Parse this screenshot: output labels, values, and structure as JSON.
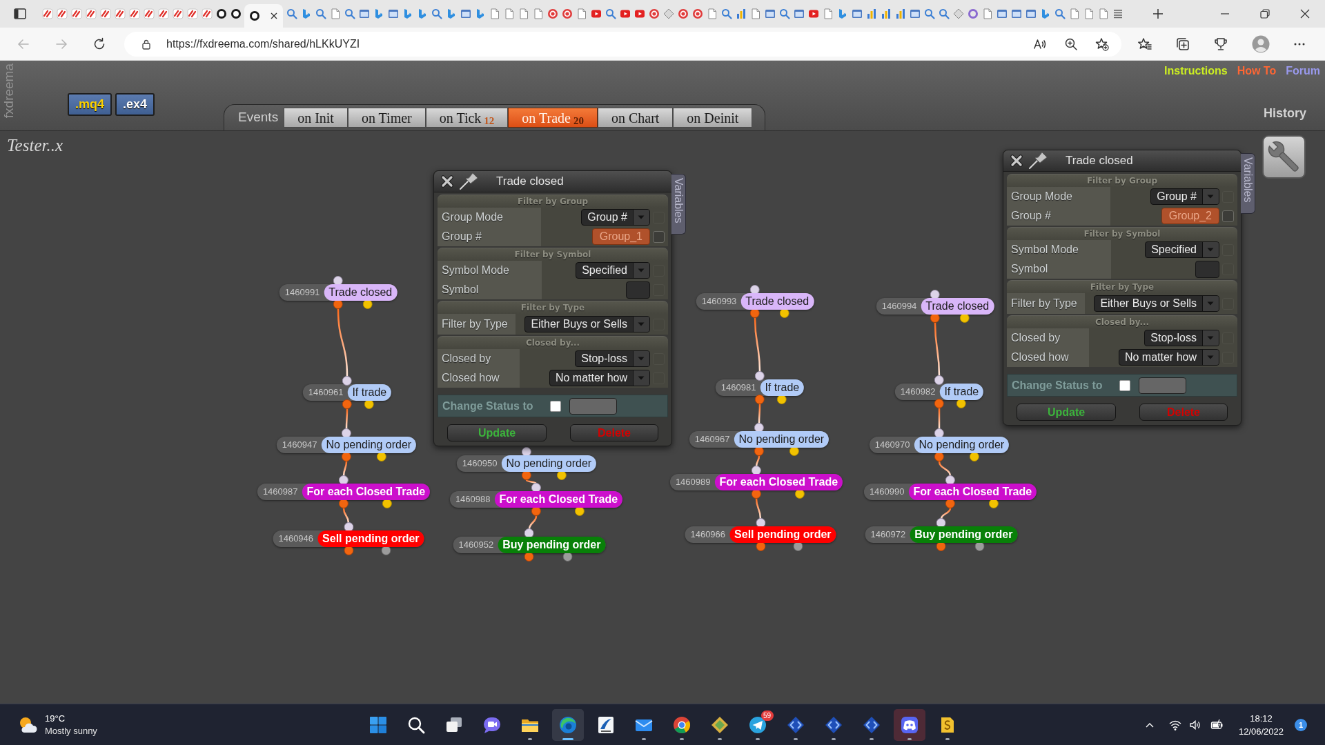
{
  "browser": {
    "tabs": [
      {
        "selected": false
      },
      {
        "selected": false
      },
      {
        "selected": false
      },
      {
        "selected": false
      },
      {
        "selected": false
      },
      {
        "selected": false
      },
      {
        "selected": false
      },
      {
        "selected": false
      },
      {
        "selected": false
      },
      {
        "selected": false
      },
      {
        "selected": false
      },
      {
        "selected": false
      },
      {
        "selected": false
      },
      {
        "selected": false
      },
      {
        "selected": true
      },
      {
        "selected": false
      },
      {
        "selected": false
      },
      {
        "selected": false
      },
      {
        "selected": false
      },
      {
        "selected": false
      },
      {
        "selected": false
      },
      {
        "selected": false
      },
      {
        "selected": false
      },
      {
        "selected": false
      },
      {
        "selected": false
      },
      {
        "selected": false
      },
      {
        "selected": false
      },
      {
        "selected": false
      },
      {
        "selected": false
      },
      {
        "selected": false
      },
      {
        "selected": false
      },
      {
        "selected": false
      },
      {
        "selected": false
      },
      {
        "selected": false
      },
      {
        "selected": false
      },
      {
        "selected": false
      },
      {
        "selected": false
      },
      {
        "selected": false
      },
      {
        "selected": false
      },
      {
        "selected": false
      },
      {
        "selected": false
      },
      {
        "selected": false
      },
      {
        "selected": false
      },
      {
        "selected": false
      },
      {
        "selected": false
      },
      {
        "selected": false
      },
      {
        "selected": false
      },
      {
        "selected": false
      },
      {
        "selected": false
      },
      {
        "selected": false
      },
      {
        "selected": false
      },
      {
        "selected": false
      },
      {
        "selected": false
      },
      {
        "selected": false
      },
      {
        "selected": false
      },
      {
        "selected": false
      },
      {
        "selected": false
      },
      {
        "selected": false
      },
      {
        "selected": false
      },
      {
        "selected": false
      },
      {
        "selected": false
      },
      {
        "selected": false
      },
      {
        "selected": false
      },
      {
        "selected": false
      },
      {
        "selected": false
      },
      {
        "selected": false
      },
      {
        "selected": false
      },
      {
        "selected": false
      },
      {
        "selected": false
      },
      {
        "selected": false
      },
      {
        "selected": false
      },
      {
        "selected": false
      },
      {
        "selected": false
      }
    ],
    "address": "https://fxdreema.com/shared/hLKkUYZI"
  },
  "header": {
    "brand": "fxdreema",
    "exports": [
      ".mq4",
      ".ex4"
    ],
    "events_label": "Events",
    "tabs": [
      {
        "label": "on Init",
        "selected": false
      },
      {
        "label": "on Timer",
        "selected": false
      },
      {
        "label": "on Tick",
        "count": "12",
        "selected": false
      },
      {
        "label": "on Trade",
        "count": "20",
        "selected": true
      },
      {
        "label": "on Chart",
        "selected": false
      },
      {
        "label": "on Deinit",
        "selected": false
      }
    ],
    "links": [
      {
        "label": "Instructions",
        "color": "#ccee22"
      },
      {
        "label": "How To",
        "color": "#ff6633"
      },
      {
        "label": "Forum",
        "color": "#9999ee"
      }
    ],
    "history": "History"
  },
  "project": "Tester..x",
  "panels": [
    {
      "title": "Trade closed",
      "side_tab": "Variables",
      "sections": [
        {
          "heading": "Filter by Group",
          "rows": [
            {
              "label": "Group Mode",
              "kind": "select",
              "value": "Group #",
              "checked": false
            },
            {
              "label": "Group #",
              "kind": "tag",
              "value": "Group_1",
              "checked": false
            }
          ]
        },
        {
          "heading": "Filter by Symbol",
          "rows": [
            {
              "label": "Symbol Mode",
              "kind": "select",
              "value": "Specified",
              "checked": false
            },
            {
              "label": "Symbol",
              "kind": "input",
              "checked": false
            }
          ]
        },
        {
          "heading": "Filter by Type",
          "rows": [
            {
              "label": "Filter by Type",
              "kind": "select",
              "value": "Either Buys or Sells",
              "checked": false
            }
          ]
        },
        {
          "heading": "Closed by...",
          "rows": [
            {
              "label": "Closed by",
              "kind": "select",
              "value": "Stop-loss",
              "checked": false
            },
            {
              "label": "Closed how",
              "kind": "select",
              "value": "No matter how",
              "checked": false
            }
          ]
        }
      ],
      "status": {
        "label": "Change Status to",
        "checked": false
      },
      "buttons": [
        {
          "label": "Update",
          "kind": "update"
        },
        {
          "label": "Delete",
          "kind": "delete"
        }
      ]
    },
    {
      "title": "Trade closed",
      "side_tab": "Variables",
      "sections": [
        {
          "heading": "Filter by Group",
          "rows": [
            {
              "label": "Group Mode",
              "kind": "select",
              "value": "Group #",
              "checked": false
            },
            {
              "label": "Group #",
              "kind": "tag",
              "value": "Group_2",
              "checked": false
            }
          ]
        },
        {
          "heading": "Filter by Symbol",
          "rows": [
            {
              "label": "Symbol Mode",
              "kind": "select",
              "value": "Specified",
              "checked": false
            },
            {
              "label": "Symbol",
              "kind": "input",
              "checked": false
            }
          ]
        },
        {
          "heading": "Filter by Type",
          "rows": [
            {
              "label": "Filter by Type",
              "kind": "select",
              "value": "Either Buys or Sells",
              "checked": false
            }
          ]
        },
        {
          "heading": "Closed by...",
          "rows": [
            {
              "label": "Closed by",
              "kind": "select",
              "value": "Stop-loss",
              "checked": false
            },
            {
              "label": "Closed how",
              "kind": "select",
              "value": "No matter how",
              "checked": false
            }
          ]
        }
      ],
      "status": {
        "label": "Change Status to",
        "checked": false
      },
      "buttons": [
        {
          "label": "Update",
          "kind": "update"
        },
        {
          "label": "Delete",
          "kind": "delete"
        }
      ]
    }
  ],
  "canvas": {
    "chains": [
      [
        {
          "id": "1460991",
          "title": "Trade closed",
          "color": "#d9b6f9",
          "kind": "condition"
        },
        {
          "id": "1460961",
          "title": "If trade",
          "color": "#b1cbf7",
          "kind": "condition"
        },
        {
          "id": "1460947",
          "title": "No pending order",
          "color": "#b1cbf7",
          "kind": "condition"
        },
        {
          "id": "1460987",
          "title": "For each Closed Trade",
          "color": "#cc0fcc",
          "kind": "condition"
        },
        {
          "id": "1460946",
          "title": "Sell pending order",
          "color": "#ff0000",
          "kind": "action"
        }
      ],
      [
        {
          "id": "1460950",
          "title": "No pending order",
          "color": "#b1cbf7",
          "kind": "condition"
        },
        {
          "id": "1460988",
          "title": "For each Closed Trade",
          "color": "#cc0fcc",
          "kind": "condition"
        },
        {
          "id": "1460952",
          "title": "Buy pending order",
          "color": "#088008",
          "kind": "action"
        }
      ],
      [
        {
          "id": "1460993",
          "title": "Trade closed",
          "color": "#d9b6f9",
          "kind": "condition"
        },
        {
          "id": "1460981",
          "title": "If trade",
          "color": "#b1cbf7",
          "kind": "condition"
        },
        {
          "id": "1460967",
          "title": "No pending order",
          "color": "#b1cbf7",
          "kind": "condition"
        },
        {
          "id": "1460989",
          "title": "For each Closed Trade",
          "color": "#cc0fcc",
          "kind": "condition"
        },
        {
          "id": "1460966",
          "title": "Sell pending order",
          "color": "#ff0000",
          "kind": "action"
        }
      ],
      [
        {
          "id": "1460994",
          "title": "Trade closed",
          "color": "#d9b6f9",
          "kind": "condition"
        },
        {
          "id": "1460982",
          "title": "If trade",
          "color": "#b1cbf7",
          "kind": "condition"
        },
        {
          "id": "1460970",
          "title": "No pending order",
          "color": "#b1cbf7",
          "kind": "condition"
        },
        {
          "id": "1460990",
          "title": "For each Closed Trade",
          "color": "#cc0fcc",
          "kind": "condition"
        },
        {
          "id": "1460972",
          "title": "Buy pending order",
          "color": "#088008",
          "kind": "action"
        }
      ]
    ]
  },
  "taskbar": {
    "weather": {
      "temperature": "19°C",
      "condition": "Mostly sunny"
    },
    "apps": [
      {
        "running": false,
        "selected": false,
        "flashing": false
      },
      {
        "running": false,
        "selected": false,
        "flashing": false
      },
      {
        "running": false,
        "selected": false,
        "flashing": false
      },
      {
        "running": false,
        "selected": false,
        "flashing": false
      },
      {
        "running": true,
        "selected": false,
        "flashing": false
      },
      {
        "running": true,
        "selected": true,
        "flashing": false
      },
      {
        "running": false,
        "selected": false,
        "flashing": false
      },
      {
        "running": true,
        "selected": false,
        "flashing": false
      },
      {
        "running": true,
        "selected": false,
        "flashing": false
      },
      {
        "running": true,
        "selected": false,
        "flashing": false
      },
      {
        "running": true,
        "selected": false,
        "flashing": false,
        "badge": "59"
      },
      {
        "running": true,
        "selected": false,
        "flashing": false
      },
      {
        "running": true,
        "selected": false,
        "flashing": false
      },
      {
        "running": true,
        "selected": false,
        "flashing": false
      },
      {
        "running": true,
        "selected": false,
        "flashing": true
      },
      {
        "running": true,
        "selected": false,
        "flashing": false
      }
    ],
    "clock": {
      "time": "18:12",
      "date": "12/06/2022"
    },
    "notifications": "1"
  }
}
